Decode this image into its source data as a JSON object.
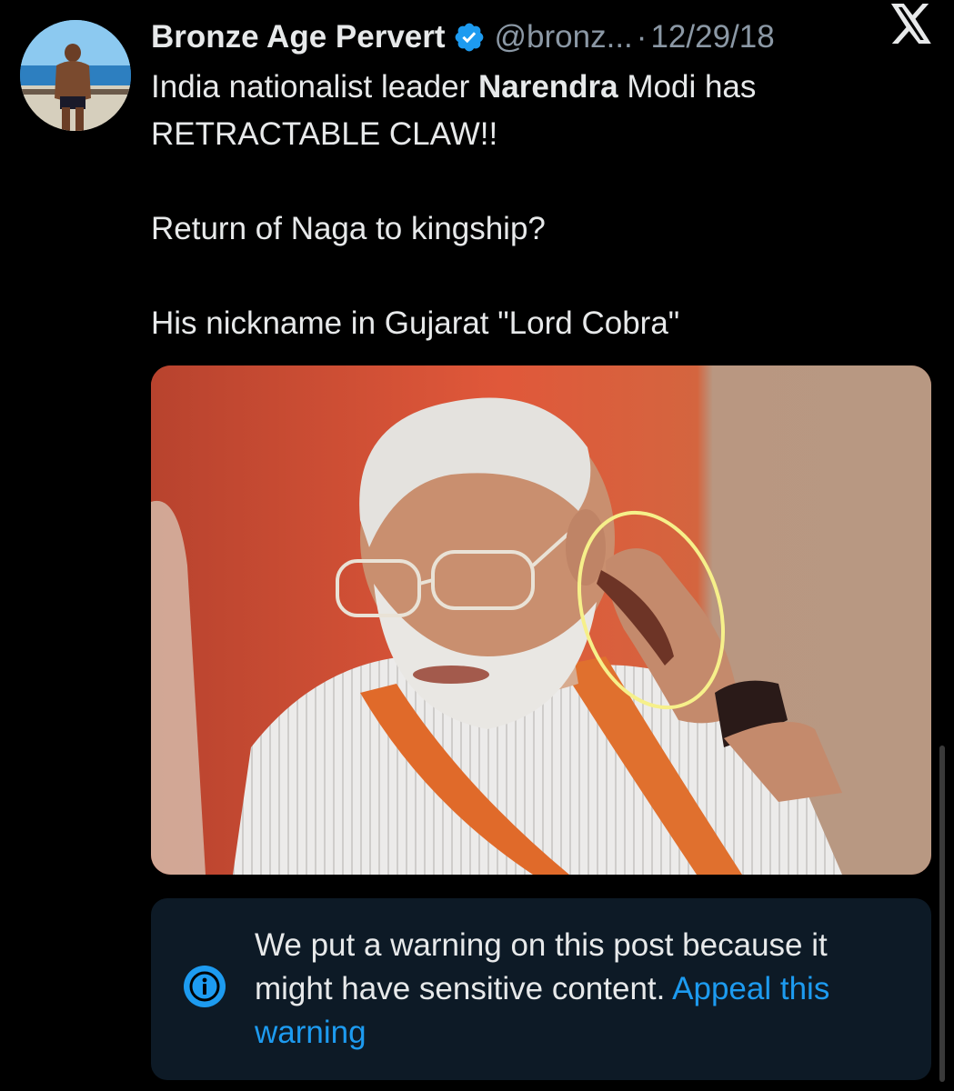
{
  "author": {
    "display_name": "Bronze Age Pervert",
    "handle": "@bronz...",
    "separator": "·",
    "date": "12/29/18",
    "verified": true,
    "avatar_icon": "profile-photo-beach"
  },
  "platform": {
    "logo_icon": "x-logo"
  },
  "tweet": {
    "line1_prefix": "India nationalist leader ",
    "line1_bold": "Narendra",
    "line1_suffix": " Modi has",
    "line2": "RETRACTABLE CLAW!!",
    "paragraph2": "Return of Naga to kingship?",
    "paragraph3": "His nickname in Gujarat \"Lord Cobra\""
  },
  "media": {
    "type": "photo",
    "annotation": "yellow-circle"
  },
  "warning": {
    "icon": "info-icon",
    "message": "We put a warning on this post because it might have sensitive content. ",
    "appeal_link": "Appeal this warning"
  },
  "colors": {
    "background": "#000000",
    "text_primary": "#e7e9ea",
    "text_secondary": "#8b98a5",
    "accent": "#1d9bf0",
    "warning_bg": "#0d1a26"
  }
}
